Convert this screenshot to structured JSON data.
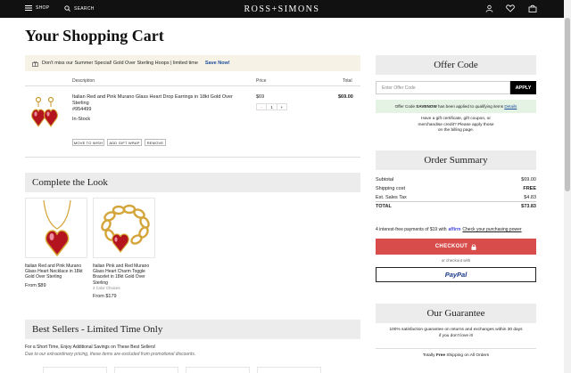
{
  "nav": {
    "shop": "SHOP",
    "search": "SEARCH",
    "logo": "ROSS+SIMONS"
  },
  "page_title": "Your Shopping Cart",
  "promo": {
    "text": "Don't miss our Summer Special! Gold Over Sterling Hoops | limited time",
    "cta": "Save Now!"
  },
  "cart": {
    "headers": {
      "description": "Description",
      "price": "Price",
      "total": "Total"
    },
    "item": {
      "name": "Italian Red and Pink Murano Glass Heart Drop Earrings in 18kt Gold Over Sterling",
      "sku": "#954499",
      "stock": "In-Stock",
      "price": "$69",
      "total": "$69.00",
      "qty": {
        "minus": "-",
        "value": "1",
        "plus": "+"
      },
      "actions": [
        "MOVE TO WISH",
        "ADD GIFT WRAP",
        "REMOVE"
      ]
    }
  },
  "complete_look": {
    "title": "Complete the Look",
    "products": [
      {
        "name": "Italian Red and Pink Murano Glass Heart Necklace in 18kt Gold Over Sterling",
        "extra": "",
        "price": "From $89"
      },
      {
        "name": "Italian Pink and Red Murano Glass Heart Charm Toggle Bracelet in 18kt Gold Over Sterling",
        "extra": "2 Color Choices",
        "price": "From $179"
      }
    ]
  },
  "best_sellers": {
    "title": "Best Sellers - Limited Time Only",
    "line1": "For a Short Time, Enjoy Additional Savings on These Best Sellers!",
    "line2": "Due to our extraordinary pricing, these items are excluded from promotional discounts."
  },
  "offer": {
    "title": "Offer Code",
    "placeholder": "Enter Offer Code",
    "apply": "APPLY",
    "applied_prefix": "Offer Code",
    "applied_code": "SAVENOW",
    "applied_suffix": "has been applied to qualifying items",
    "details": "Details",
    "gift_line1": "Have a gift certificate, gift coupon, or",
    "gift_line2": "merchandise credit? Please apply those",
    "gift_line3": "on the billing page."
  },
  "summary": {
    "title": "Order Summary",
    "rows": [
      {
        "label": "Subtotal",
        "value": "$69.00"
      },
      {
        "label": "Shipping cost",
        "value": "FREE"
      },
      {
        "label": "Est. Sales Tax",
        "value": "$4.83"
      },
      {
        "label": "TOTAL",
        "value": "$73.83"
      }
    ]
  },
  "affirm": {
    "text": "4 interest-free payments of $19 with",
    "brand": "affirm",
    "link": "Check your purchasing power"
  },
  "checkout": {
    "label": "CHECKOUT",
    "or": "or checkout with",
    "paypal": "PayPal"
  },
  "guarantee": {
    "title": "Our Guarantee",
    "line1": "100% satisfaction guarantee on returns and exchanges within 30 days",
    "line2": "if you don't love it!",
    "shipping_prefix": "Totally",
    "shipping_bold": "Free",
    "shipping_suffix": "Shipping on All Orders"
  },
  "colors": {
    "nav_bg": "#111111",
    "checkout": "#d94c4c",
    "promo_bg": "#f6f3e6",
    "offer_ok_bg": "#e5f3e5",
    "link": "#1a4a9a"
  }
}
